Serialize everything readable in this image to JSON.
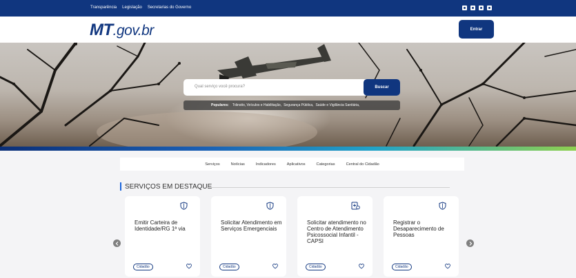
{
  "topbar": {
    "links": [
      "Transparência",
      "Legislação",
      "Secretarias do Governo"
    ],
    "social_icons": [
      "facebook-icon",
      "twitter-icon",
      "instagram-icon",
      "youtube-icon"
    ]
  },
  "header": {
    "logo_mt": "MT",
    "logo_rest": ".gov.br",
    "enter_label": "Entrar"
  },
  "hero": {
    "search_placeholder": "Qual serviço você procura?",
    "search_button": "Buscar",
    "popular_label": "Populares:",
    "popular_items": [
      "Trânsito, Veículos e Habilitação,",
      "Segurança Pública,",
      "Saúde e Vigilância Sanitária,"
    ]
  },
  "nav": {
    "items": [
      "Serviços",
      "Notícias",
      "Indicadores",
      "Aplicativos",
      "Categorias",
      "Central do Cidadão"
    ]
  },
  "section": {
    "title": "SERVIÇOS EM DESTAQUE"
  },
  "cards": [
    {
      "title": "Emitir Carteira de Identidade/RG 1ª via",
      "tag": "Cidadão",
      "icon": "shield-icon"
    },
    {
      "title": "Solicitar Atendimento em Serviços Emergenciais",
      "tag": "Cidadão",
      "icon": "shield-icon"
    },
    {
      "title": "Solicitar atendimento no Centro de Atendimento Psicossocial Infantil - CAPSI",
      "tag": "Cidadão",
      "icon": "health-icon"
    },
    {
      "title": "Registrar o Desaparecimento de Pessoas",
      "tag": "Cidadão",
      "icon": "shield-icon"
    }
  ],
  "colors": {
    "brand": "#10367f",
    "accent": "#1863dc"
  }
}
